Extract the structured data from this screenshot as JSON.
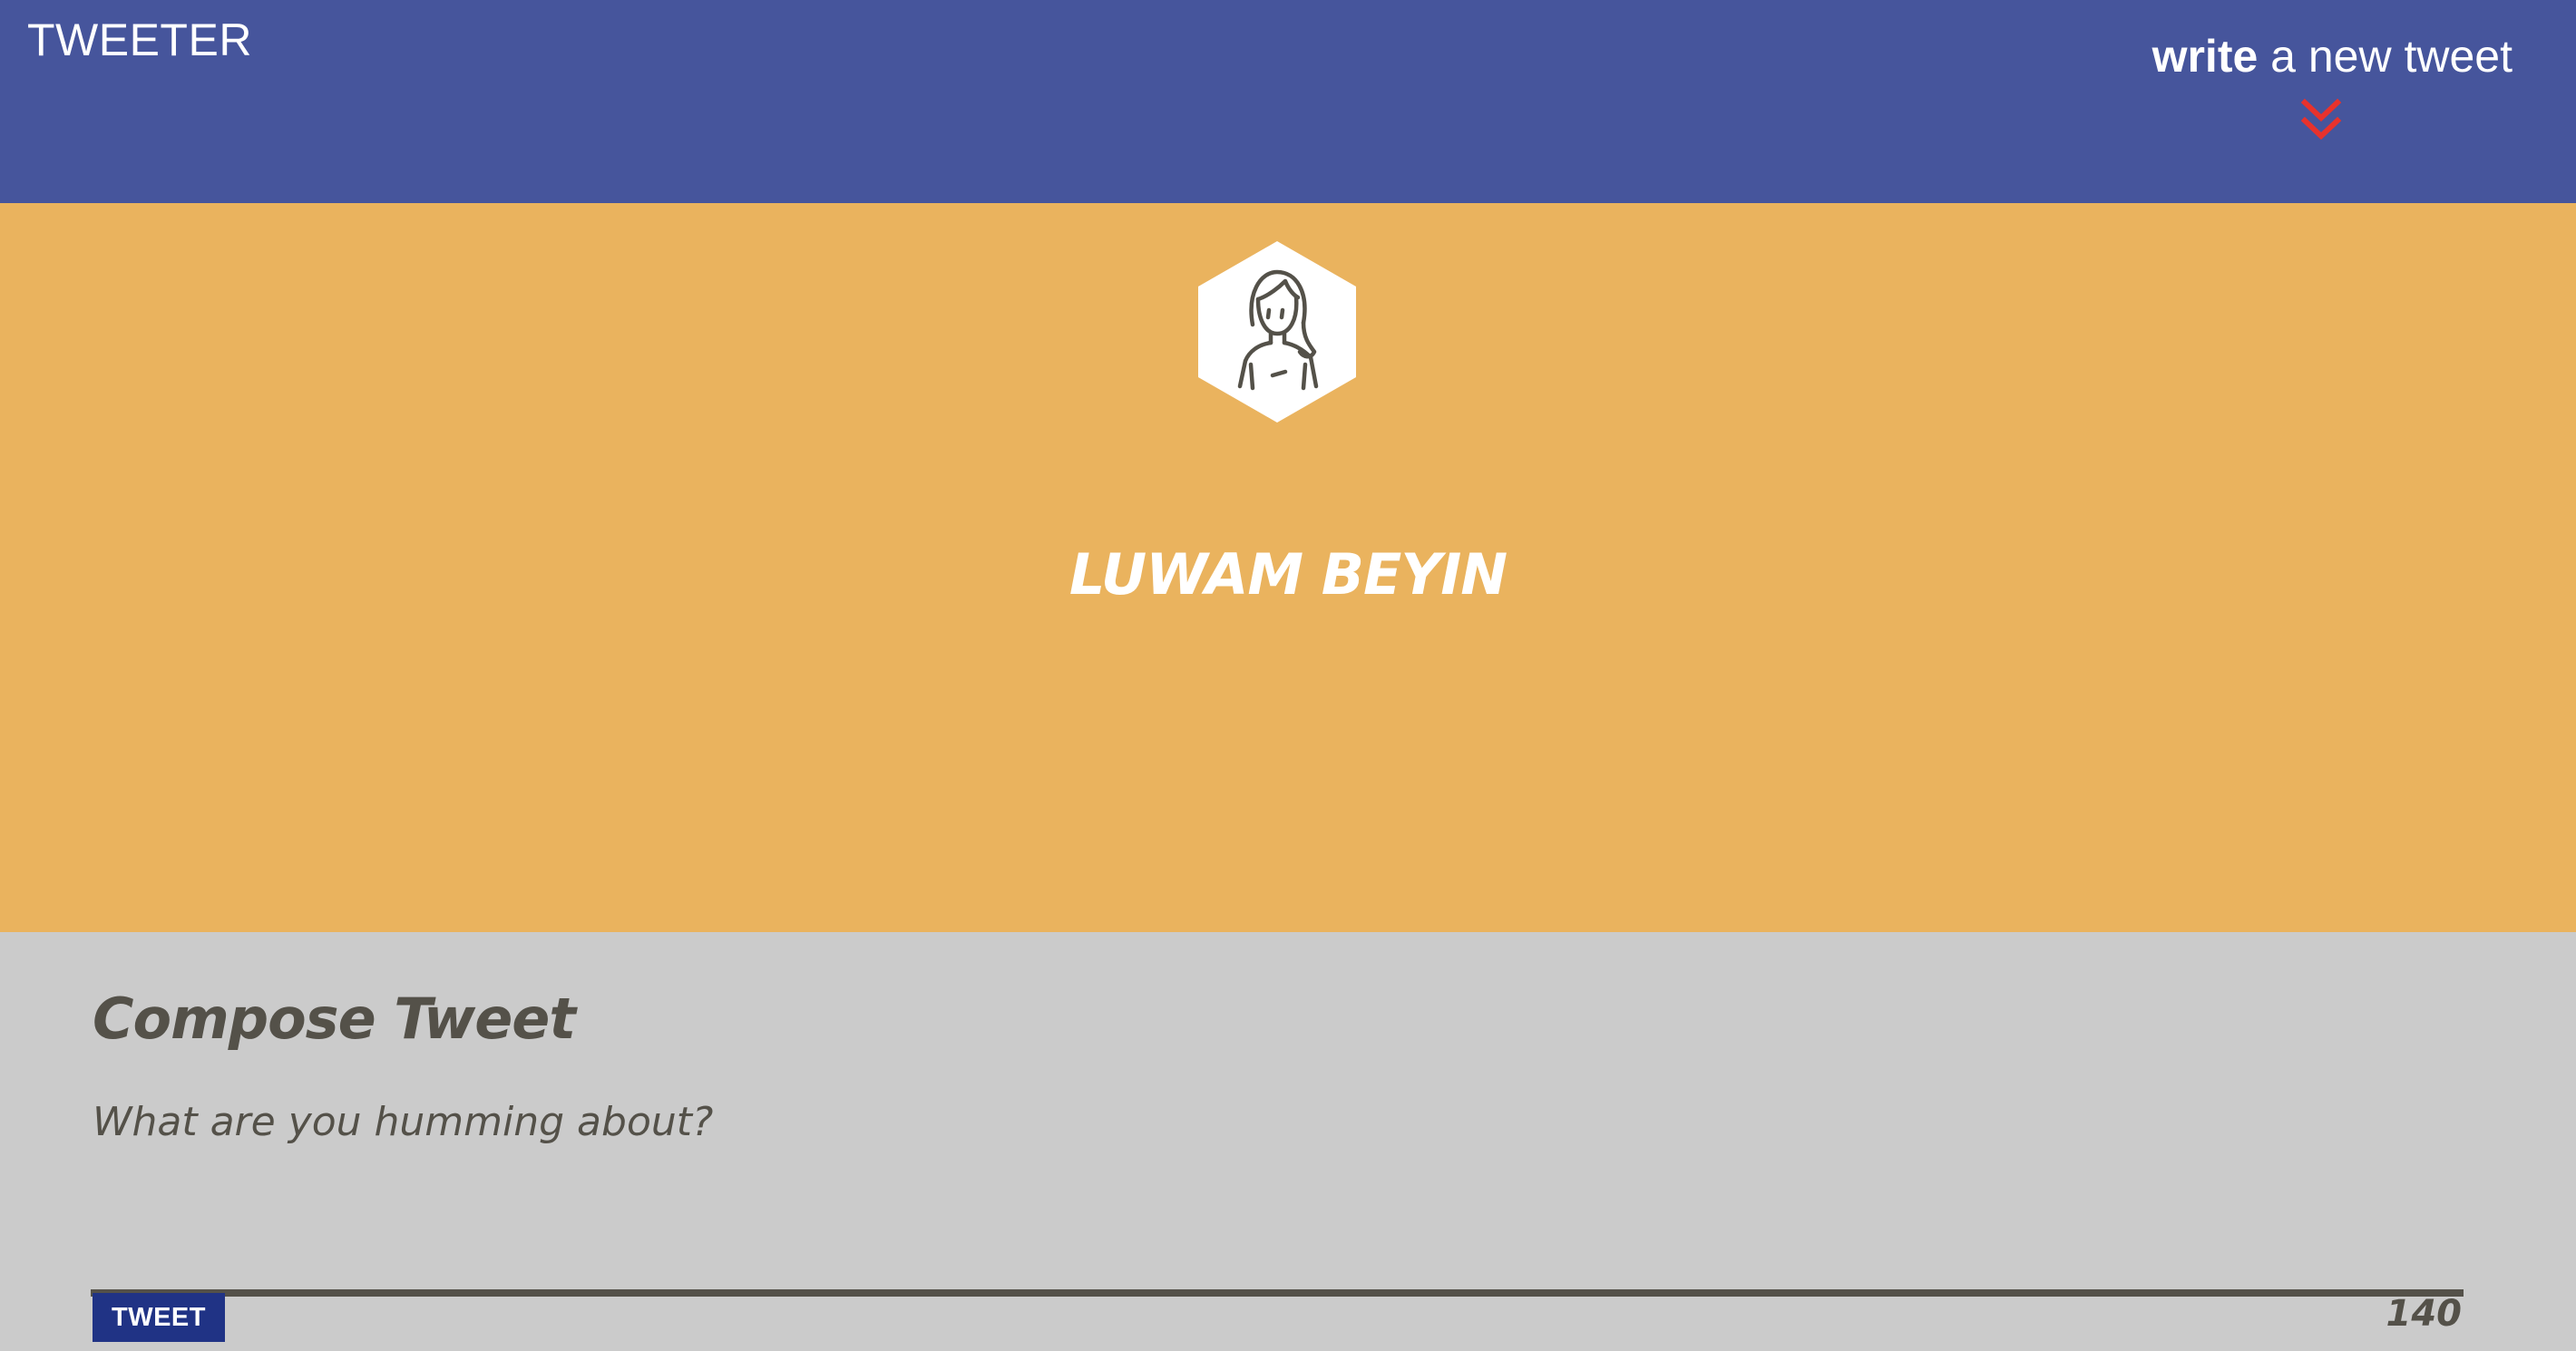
{
  "nav": {
    "brand": "TWEETER",
    "compose_toggle": {
      "bold": "write",
      "rest": " a new tweet",
      "icon": "double-chevron-down-icon",
      "icon_color": "#e8322c"
    },
    "background": "#46559c"
  },
  "profile": {
    "avatar_icon": "user-avatar-icon",
    "name": "LUWAM BEYIN",
    "background": "#eab35e"
  },
  "compose": {
    "title": "Compose Tweet",
    "placeholder": "What are you humming about?",
    "value": "",
    "submit_label": "TWEET",
    "char_count": "140",
    "button_color": "#203385"
  }
}
